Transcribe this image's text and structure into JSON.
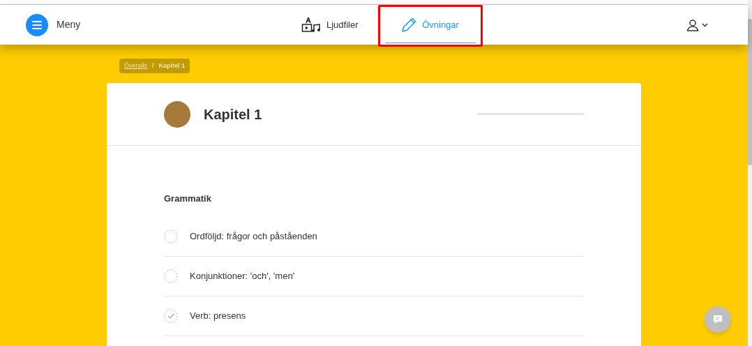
{
  "header": {
    "menu_label": "Meny",
    "nav": [
      {
        "label": "Ljudfiler",
        "kind": "media",
        "selected": false,
        "highlighted": false
      },
      {
        "label": "Övningar",
        "kind": "exercises",
        "selected": true,
        "highlighted": true
      }
    ]
  },
  "breadcrumb": [
    {
      "label": "Översikt",
      "kind": "link"
    },
    {
      "label": "/",
      "kind": "separator"
    },
    {
      "label": "Kapitel 1",
      "kind": "current"
    }
  ],
  "chapter": {
    "title": "Kapitel 1"
  },
  "section": {
    "title": "Grammatik",
    "items": [
      {
        "label": "Ordföljd: frågor och påståenden",
        "done": false
      },
      {
        "label": "Konjunktioner: 'och', 'men'",
        "done": false
      },
      {
        "label": "Verb: presens",
        "done": true
      }
    ]
  }
}
